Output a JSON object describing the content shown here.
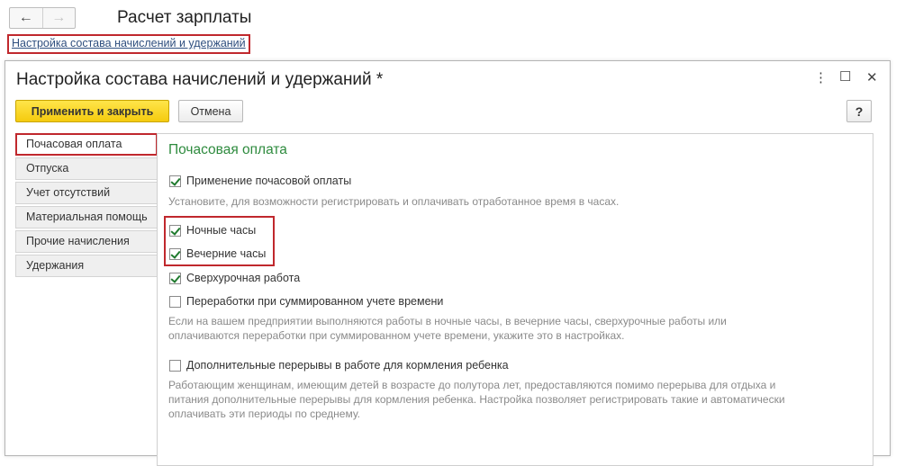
{
  "window": {
    "title": "Расчет зарплаты",
    "breadcrumb_link": "Настройка состава начислений и удержаний",
    "nav": {
      "back_icon": "←",
      "forward_icon": "→"
    }
  },
  "dialog": {
    "title": "Настройка состава начислений и удержаний *",
    "controls": {
      "more": "⋮",
      "maximize": "☐",
      "close": "✕"
    },
    "toolbar": {
      "apply_label": "Применить и закрыть",
      "cancel_label": "Отмена",
      "help_label": "?"
    },
    "tabs": [
      {
        "label": "Почасовая оплата",
        "active": true
      },
      {
        "label": "Отпуска"
      },
      {
        "label": "Учет отсутствий"
      },
      {
        "label": "Материальная помощь"
      },
      {
        "label": "Прочие начисления"
      },
      {
        "label": "Удержания"
      }
    ],
    "section": {
      "title": "Почасовая оплата",
      "items": [
        {
          "label": "Применение почасовой оплаты",
          "checked": true
        },
        {
          "hint": "Установите, для возможности регистрировать и оплачивать отработанное время в часах."
        },
        {
          "label": "Ночные часы",
          "checked": true
        },
        {
          "label": "Вечерние часы",
          "checked": true
        },
        {
          "label": "Сверхурочная работа",
          "checked": true
        },
        {
          "label": "Переработки при суммированном учете времени",
          "checked": false
        },
        {
          "hint": "Если на вашем предприятии выполняются работы в ночные часы, в вечерние часы, сверхурочные работы или оплачиваются переработки при суммированном учете времени, укажите это в настройках."
        },
        {
          "label": "Дополнительные перерывы в работе для кормления ребенка",
          "checked": false
        },
        {
          "hint": "Работающим женщинам, имеющим детей в возрасте до полутора лет, предоставляются помимо перерыва для отдыха и питания дополнительные перерывы для кормления ребенка. Настройка позволяет регистрировать такие и автоматически оплачивать эти периоды по среднему."
        }
      ]
    }
  },
  "colors": {
    "accent_highlight": "#c0282d",
    "section_title": "#2e8b3e",
    "apply_button": "#f5cb0e",
    "checkmark": "#1f7a2e"
  }
}
